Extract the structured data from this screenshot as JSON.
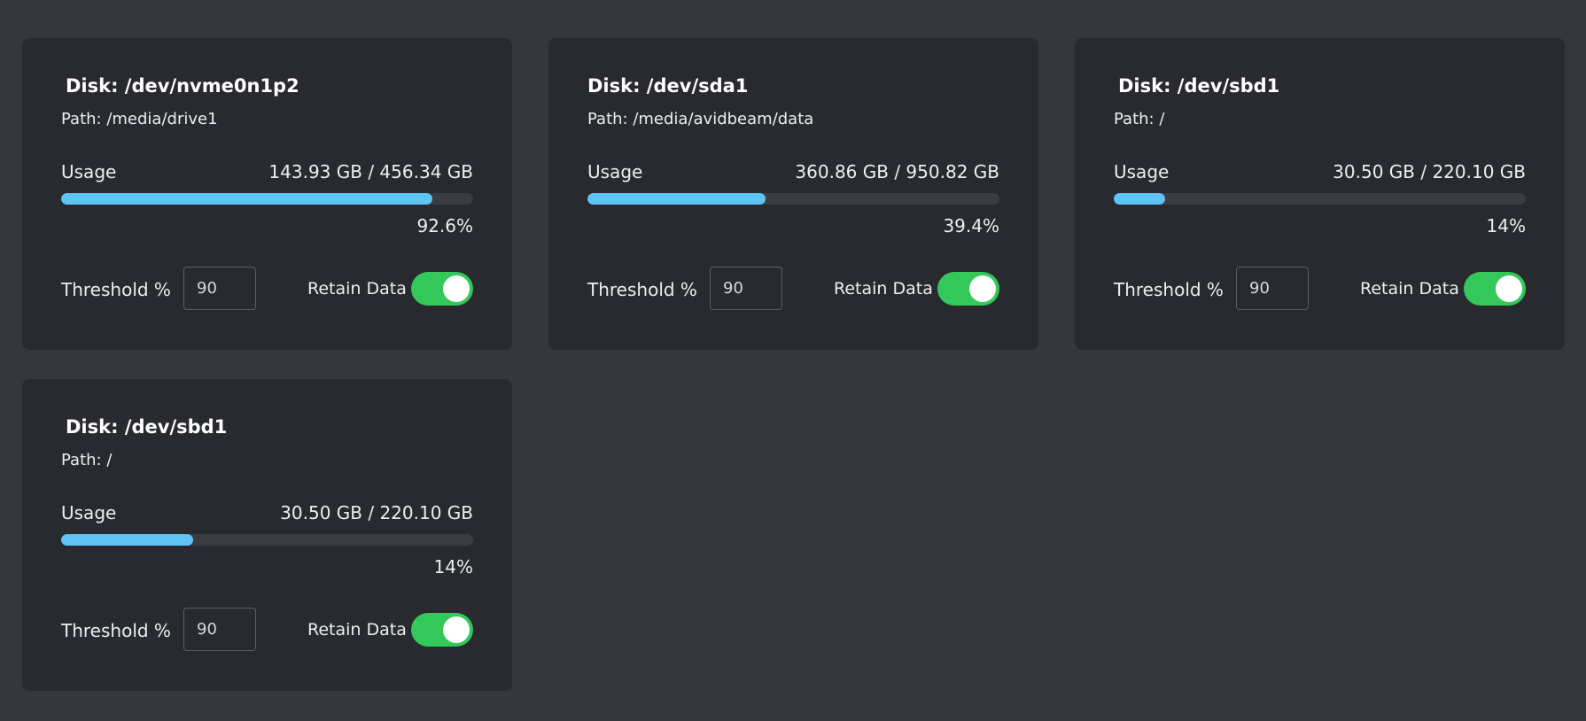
{
  "disks": [
    {
      "title": "Disk: /dev/nvme0n1p2",
      "path": "Path: /media/drive1",
      "usage_label": "Usage",
      "usage_values": "143.93 GB / 456.34 GB",
      "percent_text": "92.6%",
      "usage_fraction": 0.9,
      "threshold_label": "Threshold %",
      "threshold_value": "90",
      "retain_label": "Retain Data",
      "retain_on": true
    },
    {
      "title": "Disk: /dev/sda1",
      "path": "Path: /media/avidbeam/data",
      "usage_label": "Usage",
      "usage_values": "360.86 GB / 950.82 GB",
      "percent_text": "39.4%",
      "usage_fraction": 0.432,
      "threshold_label": "Threshold %",
      "threshold_value": "90",
      "retain_label": "Retain Data",
      "retain_on": true
    },
    {
      "title": "Disk: /dev/sbd1",
      "path": "Path: /",
      "usage_label": "Usage",
      "usage_values": "30.50 GB / 220.10 GB",
      "percent_text": "14%",
      "usage_fraction": 0.125,
      "threshold_label": "Threshold %",
      "threshold_value": "90",
      "retain_label": "Retain Data",
      "retain_on": true
    },
    {
      "title": "Disk: /dev/sbd1",
      "path": "Path: /",
      "usage_label": "Usage",
      "usage_values": "30.50 GB / 220.10 GB",
      "percent_text": "14%",
      "usage_fraction": 0.32,
      "threshold_label": "Threshold %",
      "threshold_value": "90",
      "retain_label": "Retain Data",
      "retain_on": true
    }
  ],
  "colors": {
    "background": "#36373c",
    "card": "#282a2f",
    "bar_fill": "#5ec4f5",
    "bar_track": "#3a3c42",
    "toggle_on": "#34c759"
  }
}
